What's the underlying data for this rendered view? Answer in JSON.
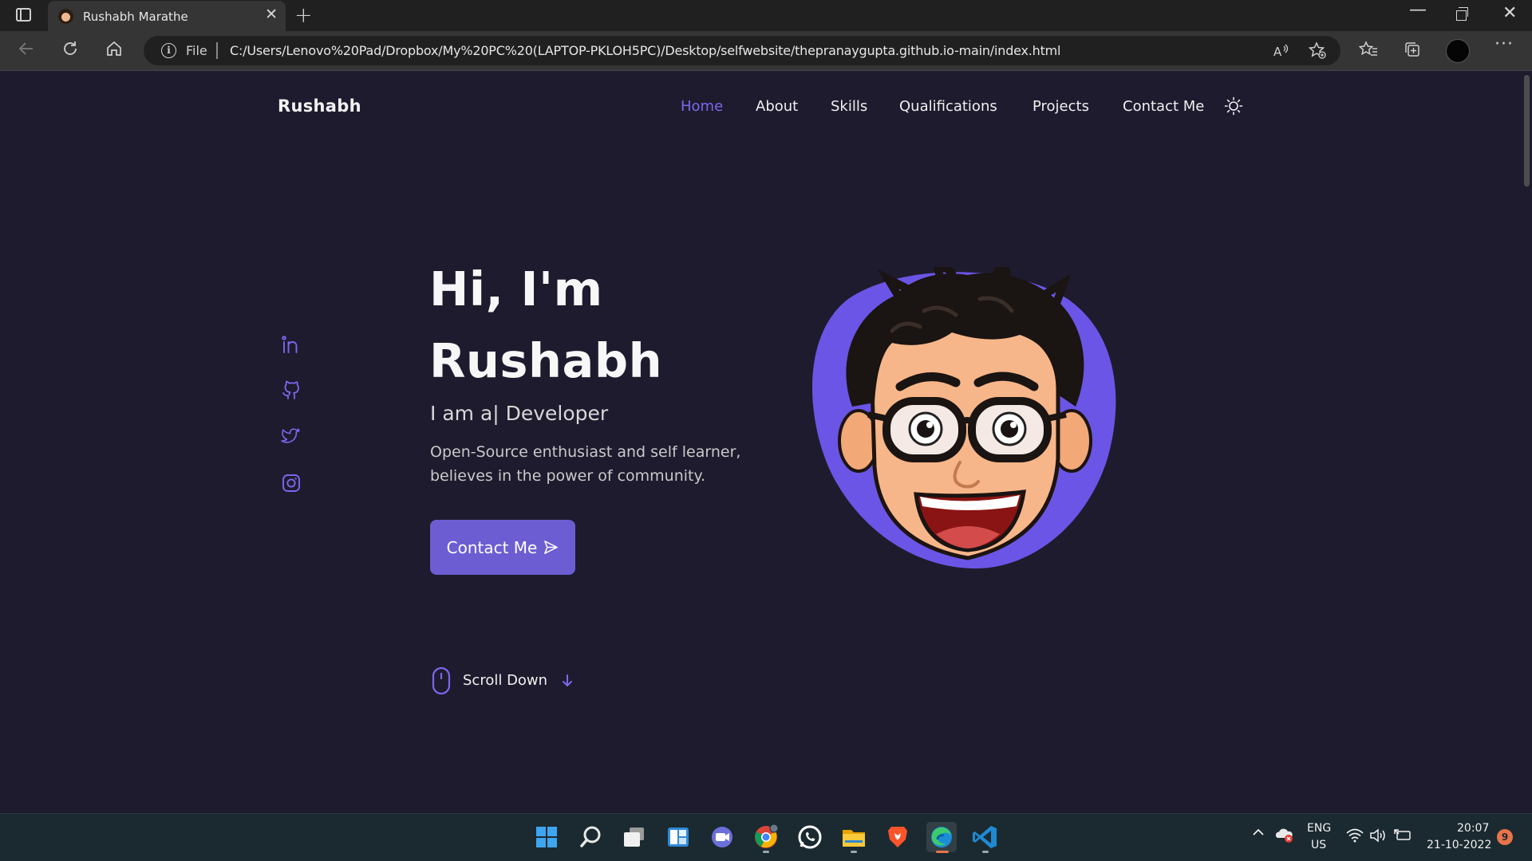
{
  "browser": {
    "tab_title": "Rushabh Marathe",
    "tab_close": "✕",
    "new_tab": "+",
    "file_label": "File",
    "url": "C:/Users/Lenovo%20Pad/Dropbox/My%20PC%20(LAPTOP-PKLOH5PC)/Desktop/selfwebsite/thepranaygupta.github.io-main/index.html",
    "read_aloud": "A",
    "more": "···",
    "window_min": "—",
    "window_close": "✕"
  },
  "site": {
    "logo": "Rushabh",
    "nav": [
      {
        "label": "Home",
        "active": true
      },
      {
        "label": "About",
        "active": false
      },
      {
        "label": "Skills",
        "active": false
      },
      {
        "label": "Qualifications",
        "active": false
      },
      {
        "label": "Projects",
        "active": false
      },
      {
        "label": "Contact Me",
        "active": false
      }
    ],
    "socials": [
      "linkedin-icon",
      "github-icon",
      "twitter-icon",
      "instagram-icon"
    ],
    "hero": {
      "title_line1": "Hi, I'm",
      "title_line2": "Rushabh",
      "subtitle": "I am a| Developer",
      "description": "Open-Source enthusiast and self learner, believes in the power of community.",
      "cta": "Contact Me"
    },
    "scroll_down": "Scroll Down"
  },
  "colors": {
    "accent": "#6c5dd3",
    "nav_active": "#7b68ee",
    "background": "#1e1b2e",
    "avatar_blob": "#6b55e6"
  },
  "taskbar": {
    "apps": [
      "start-icon",
      "search-icon",
      "task-view-icon",
      "widgets-icon",
      "teams-chat-icon",
      "chrome-icon",
      "whatsapp-icon",
      "file-explorer-icon",
      "brave-icon",
      "edge-icon",
      "vscode-icon"
    ],
    "language": "ENG",
    "region": "US",
    "time": "20:07",
    "date": "21-10-2022",
    "notifications": "9"
  }
}
